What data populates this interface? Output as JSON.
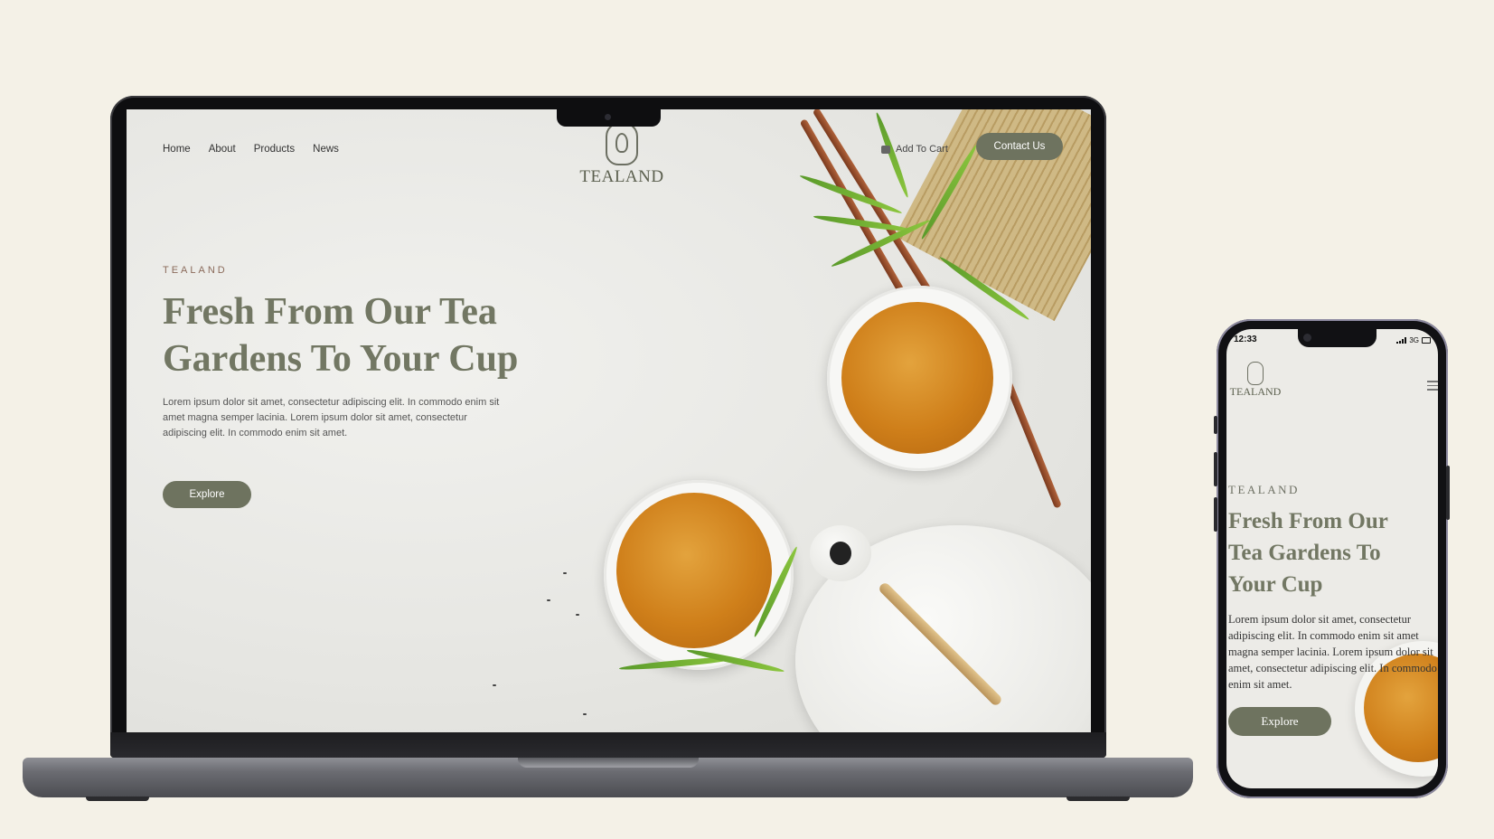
{
  "laptop": {
    "nav": [
      "Home",
      "About",
      "Products",
      "News"
    ],
    "brand": "TEALAND",
    "cart_label": "Add To Cart",
    "contact_label": "Contact Us",
    "hero": {
      "eyebrow": "TEALAND",
      "title": "Fresh From Our Tea Gardens To Your Cup",
      "body": "Lorem ipsum dolor sit amet, consectetur adipiscing elit. In commodo enim sit amet magna semper lacinia. Lorem ipsum dolor sit amet, consectetur adipiscing elit. In commodo enim sit amet.",
      "cta": "Explore"
    }
  },
  "phone": {
    "status": {
      "time": "12:33",
      "network": "3G"
    },
    "brand": "TEALAND",
    "hero": {
      "eyebrow": "TEALAND",
      "title": "Fresh From Our Tea Gardens To Your Cup",
      "body": "Lorem ipsum dolor sit amet, consectetur adipiscing elit. In commodo enim sit amet magna semper lacinia. Lorem ipsum dolor sit amet, consectetur adipiscing elit. In commodo enim sit amet.",
      "cta": "Explore"
    }
  },
  "colors": {
    "background": "#f4f1e7",
    "accent": "#6e735f",
    "title": "#727763",
    "eyebrow": "#8a6a5a"
  },
  "icons": [
    "tealand-logo-icon",
    "cart-icon",
    "hamburger-menu-icon",
    "signal-icon",
    "battery-icon"
  ]
}
